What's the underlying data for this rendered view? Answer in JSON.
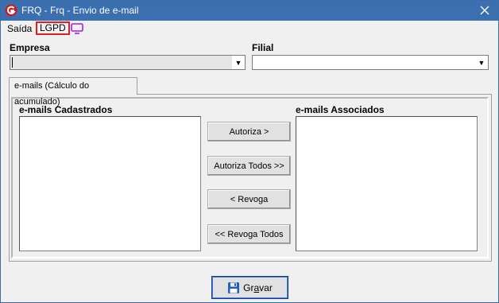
{
  "window": {
    "title": "FRQ - Frq - Envio de e-mail"
  },
  "menu": {
    "saida": "Saída",
    "lgpd": "LGPD"
  },
  "empresa": {
    "label": "Empresa",
    "value": ""
  },
  "filial": {
    "label": "Filial",
    "value": ""
  },
  "tab": {
    "label": "e-mails (Cálculo do acumulado)"
  },
  "lists": {
    "cadastrados_label": "e-mails Cadastrados",
    "associados_label": "e-mails Associados"
  },
  "buttons": {
    "autoriza": "Autoriza >",
    "autoriza_todos": "Autoriza Todos >>",
    "revoga": "< Revoga",
    "revoga_todos": "<< Revoga Todos",
    "gravar_prefix": "Gr",
    "gravar_accel": "a",
    "gravar_suffix": "var"
  },
  "icons": {
    "app": "app-logo-icon",
    "close": "close-icon",
    "tv": "monitor-icon",
    "save": "floppy-disk-icon"
  },
  "colors": {
    "titlebar": "#3c6fb0",
    "lgpd_border": "#e02020",
    "tv_icon": "#a020f0",
    "save_disk": "#1f5fbf"
  }
}
